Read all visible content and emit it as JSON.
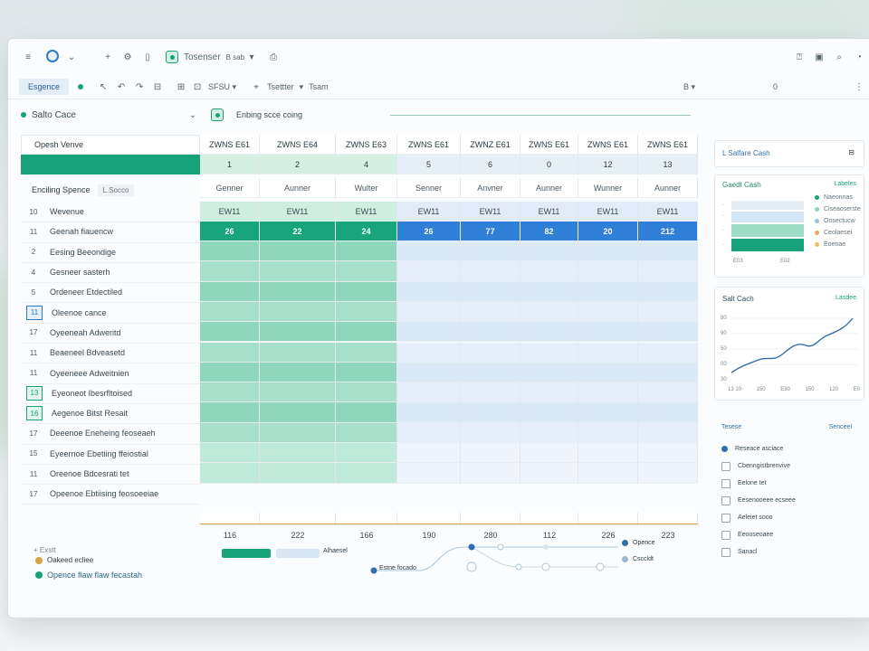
{
  "toolbar": {
    "menu_label": "≡",
    "tab_title": "Tosenser",
    "tab_suffix": "B sab",
    "view_pill": "Esgence",
    "filter_label": "SFSU",
    "filter_label2": "Tsettter",
    "filter_label3": "Tsam",
    "zoom_label": "B",
    "top_right_num": "0"
  },
  "formula_bar": {
    "cell_ref": "Salto Cace",
    "formula_text": "Enbing scce coing"
  },
  "sheet": {
    "corner_label": "Opesh Venve",
    "header2_label": "Enciling Spence",
    "header2_tag": "L.Socco",
    "columns": [
      "ZWNS E61",
      "ZWNS E64",
      "ZWNS E63",
      "ZWNS E61",
      "ZWNZ E61",
      "ZWNS E61",
      "ZWNS E61",
      "ZWNS E61"
    ],
    "index_row": [
      "1",
      "2",
      "4",
      "5",
      "6",
      "0",
      "12",
      "13"
    ],
    "subheads": [
      "Genner",
      "Aunner",
      "Wulter",
      "Senner",
      "Anvner",
      "Aunner",
      "Wunner",
      "Aunner"
    ],
    "row_codes": [
      "EW11",
      "EW11",
      "EW11",
      "EW11",
      "EW11",
      "EW11",
      "EW11",
      "EW11"
    ],
    "values": [
      "26",
      "22",
      "24",
      "26",
      "77",
      "82",
      "20",
      "212"
    ],
    "totals": [
      "116",
      "222",
      "166",
      "190",
      "280",
      "112",
      "226",
      "223"
    ],
    "rows": [
      {
        "num": "10",
        "label": "Wevenue",
        "sel": ""
      },
      {
        "num": "11",
        "label": "Geenah fiauencw",
        "sel": ""
      },
      {
        "num": "2",
        "label": "Eesing Beeondige",
        "sel": ""
      },
      {
        "num": "4",
        "label": "Gesneer sasterh",
        "sel": ""
      },
      {
        "num": "5",
        "label": "Ordeneer Etdectiled",
        "sel": ""
      },
      {
        "num": "11",
        "label": "Oleenoe cance",
        "sel": "blue"
      },
      {
        "num": "17",
        "label": "Oyeeneah  Adweritd",
        "sel": ""
      },
      {
        "num": "11",
        "label": "Beaeneel  Bdveasetd",
        "sel": ""
      },
      {
        "num": "11",
        "label": "Oyeeneee  Adweitnien",
        "sel": ""
      },
      {
        "num": "13",
        "label": "Eyeoneot  Ibesrfltoised",
        "sel": "green"
      },
      {
        "num": "16",
        "label": "Aegenoe  Bitst Resait",
        "sel": "green"
      },
      {
        "num": "17",
        "label": "Deeenoe  Eneheing feoseaeh",
        "sel": ""
      },
      {
        "num": "15",
        "label": "Eyeernoe  Ebetiing ffeiostial",
        "sel": ""
      },
      {
        "num": "11",
        "label": "Oreenoe  Bdcesrati tet",
        "sel": ""
      },
      {
        "num": "17",
        "label": "Opeenoe  Ebtiising feosoeeiae",
        "sel": ""
      }
    ],
    "footer_label": "+ Exstt"
  },
  "right_panel": {
    "card1_title": "L  Salfare Cash",
    "card2_title": "Gaedt Cash",
    "card2_legend_title": "Labeles",
    "card2_legend": [
      "Naeonnas",
      "Ciseaoserste",
      "Oosectucw",
      "Ceolaesei",
      "Eoenae"
    ],
    "card2_xlabels": [
      "E03",
      "E02"
    ],
    "card3_title": "Salt Cach",
    "card3_legend": "Lasdee",
    "card3_xlabels": [
      "13 10",
      "150",
      "E30",
      "150",
      "120",
      "E0"
    ],
    "card3_yticks": [
      "80",
      "90",
      "50",
      "00",
      "30"
    ],
    "card4_title": "Tesese",
    "card4_tag": "Senceel",
    "card4_items": [
      {
        "label": "Reseace asciace",
        "type": "dot"
      },
      {
        "label": "Cbenngistbrenvive",
        "type": "chk"
      },
      {
        "label": "Eelone tet",
        "type": "chk"
      },
      {
        "label": "Eesenooeee ecseee",
        "type": "chk"
      },
      {
        "label": "Aeleiet sooo",
        "type": "chk"
      },
      {
        "label": "Eeooseoaee",
        "type": "chk"
      },
      {
        "label": "Sanacl",
        "type": "chk"
      }
    ]
  },
  "bottom": {
    "legend1": "Oakeed ecliee",
    "legend2": "Opence flaw flaw fecastah",
    "bar_label": "Alhaesel",
    "flow_label": "Estne focado",
    "flow_right1": "Opence",
    "flow_right2": "Csccldt"
  },
  "colors": {
    "green": "#1aa37a",
    "green_light": "#8fd7bc",
    "blue": "#2f7fd6",
    "blue_light": "#dce9f7"
  }
}
